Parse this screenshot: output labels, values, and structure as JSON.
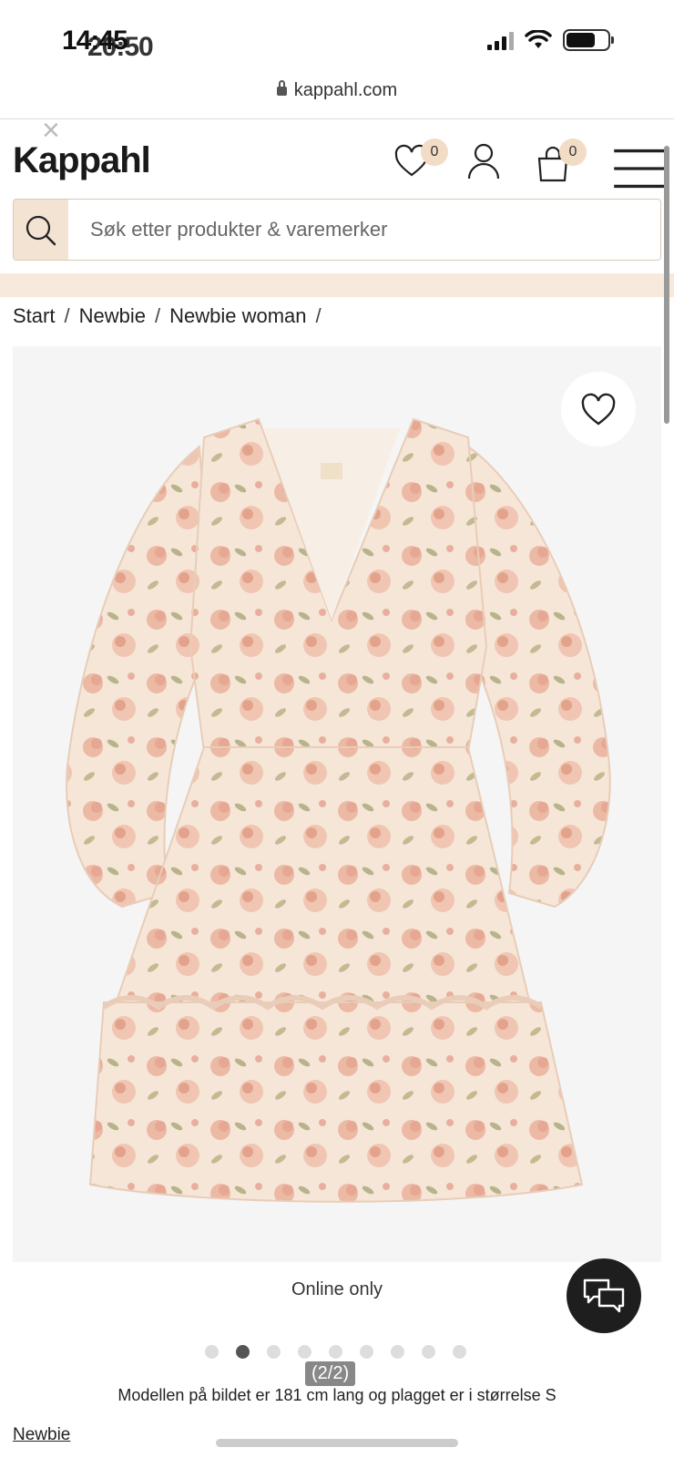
{
  "status_bar": {
    "time_primary": "14:45",
    "time_overlay": "20:50"
  },
  "browser": {
    "url": "kappahl.com"
  },
  "header": {
    "logo": "Kappahl",
    "close_symbol": "×",
    "wishlist_count": "0",
    "cart_count": "0"
  },
  "search": {
    "placeholder": "Søk etter produkter & varemerker"
  },
  "breadcrumb": [
    {
      "label": "Start"
    },
    {
      "label": "Newbie"
    },
    {
      "label": "Newbie woman"
    }
  ],
  "breadcrumb_separator": "/",
  "product": {
    "badge": "Online only",
    "image_counter": "(2/2)",
    "model_info": "Modellen på bildet er 181 cm lang og plagget er i størrelse S",
    "brand_link": "Newbie",
    "gallery_total": 9,
    "gallery_active_index": 1
  },
  "colors": {
    "accent_beige": "#f3e3d3",
    "chat_button": "#1e1e1e"
  },
  "icons": [
    "lock-icon",
    "heart-icon",
    "user-icon",
    "bag-icon",
    "menu-icon",
    "search-icon",
    "chat-icon",
    "close-icon"
  ]
}
